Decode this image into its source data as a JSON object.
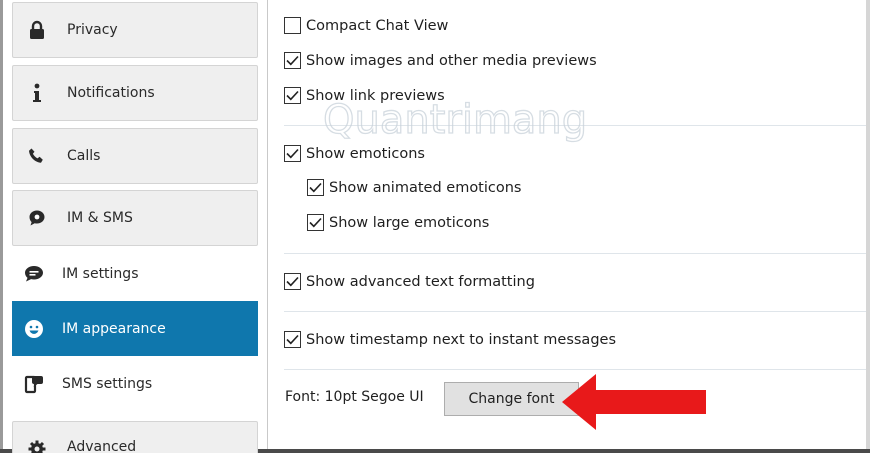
{
  "sidebar": {
    "items": [
      {
        "label": "Privacy",
        "icon": "lock-icon"
      },
      {
        "label": "Notifications",
        "icon": "info-icon"
      },
      {
        "label": "Calls",
        "icon": "phone-icon"
      },
      {
        "label": "IM & SMS",
        "icon": "chat-bubble-icon"
      },
      {
        "label": "IM settings",
        "icon": "message-icon"
      },
      {
        "label": "IM appearance",
        "icon": "smiley-icon",
        "active": true
      },
      {
        "label": "SMS settings",
        "icon": "sms-icon"
      },
      {
        "label": "Advanced",
        "icon": "gear-icon"
      }
    ]
  },
  "options": [
    {
      "label": "Compact Chat View",
      "checked": false
    },
    {
      "label": "Show images and other media previews",
      "checked": true
    },
    {
      "label": "Show link previews",
      "checked": true
    },
    {
      "label": "Show emoticons",
      "checked": true
    },
    {
      "label": "Show animated emoticons",
      "checked": true
    },
    {
      "label": "Show large emoticons",
      "checked": true
    },
    {
      "label": "Show advanced text formatting",
      "checked": true
    },
    {
      "label": "Show timestamp next to instant messages",
      "checked": true
    }
  ],
  "font": {
    "label": "Font: 10pt Segoe UI",
    "button": "Change font"
  },
  "watermark": "Quantrimang",
  "colors": {
    "active_bg": "#0f77ad",
    "arrow": "#e8191a"
  }
}
